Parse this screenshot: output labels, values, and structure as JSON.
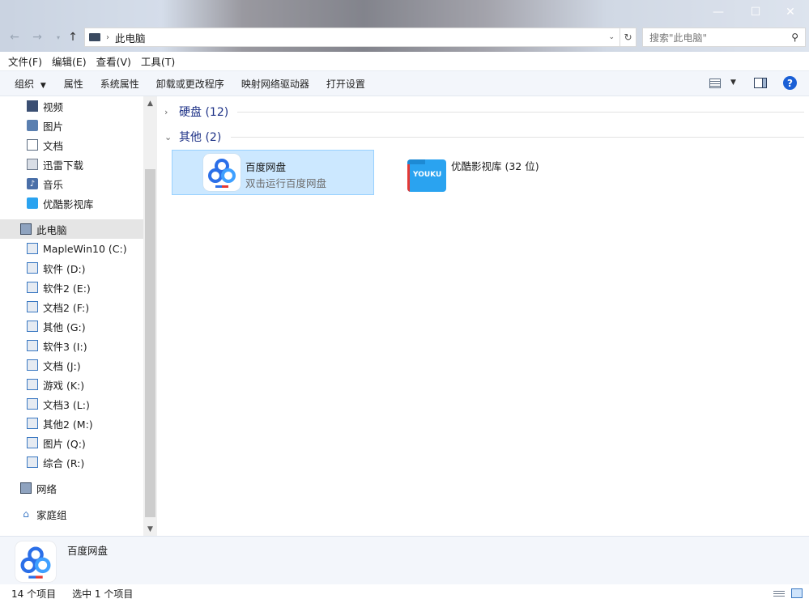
{
  "window": {
    "minimize": "—",
    "maximize": "☐",
    "close": "✕"
  },
  "address": {
    "breadcrumb": "此电脑"
  },
  "search": {
    "placeholder": "搜索\"此电脑\""
  },
  "menu": [
    {
      "label": "文件(F)"
    },
    {
      "label": "编辑(E)"
    },
    {
      "label": "查看(V)"
    },
    {
      "label": "工具(T)"
    }
  ],
  "commands": {
    "organize": "组织",
    "properties": "属性",
    "system_properties": "系统属性",
    "uninstall": "卸载或更改程序",
    "map_drive": "映射网络驱动器",
    "open_settings": "打开设置"
  },
  "sidebar": {
    "quick": [
      {
        "label": "视频",
        "icon": "video-icon"
      },
      {
        "label": "图片",
        "icon": "picture-icon"
      },
      {
        "label": "文档",
        "icon": "document-icon"
      },
      {
        "label": "迅雷下载",
        "icon": "download-icon"
      },
      {
        "label": "音乐",
        "icon": "music-icon"
      },
      {
        "label": "优酷影视库",
        "icon": "youku-icon"
      }
    ],
    "this_pc": "此电脑",
    "drives": [
      {
        "label": "MapleWin10 (C:)"
      },
      {
        "label": "软件 (D:)"
      },
      {
        "label": "软件2 (E:)"
      },
      {
        "label": "文档2 (F:)"
      },
      {
        "label": "其他 (G:)"
      },
      {
        "label": "软件3 (I:)"
      },
      {
        "label": "文档 (J:)"
      },
      {
        "label": "游戏 (K:)"
      },
      {
        "label": "文档3 (L:)"
      },
      {
        "label": "其他2 (M:)"
      },
      {
        "label": "图片 (Q:)"
      },
      {
        "label": "综合 (R:)"
      }
    ],
    "network": "网络",
    "homegroup": "家庭组"
  },
  "content": {
    "group_disks": "硬盘 (12)",
    "group_other": "其他 (2)",
    "items": [
      {
        "name": "百度网盘",
        "subtitle": "双击运行百度网盘"
      },
      {
        "name": "优酷影视库 (32 位)",
        "logo_text": "YOUKU"
      }
    ]
  },
  "details": {
    "name": "百度网盘"
  },
  "status": {
    "count": "14 个项目",
    "selected": "选中 1 个项目"
  },
  "colors": {
    "accent": "#1e3287",
    "selection": "#cce8ff",
    "baidu_blue": "#2b6fe8",
    "youku_blue": "#2aa3f0"
  }
}
